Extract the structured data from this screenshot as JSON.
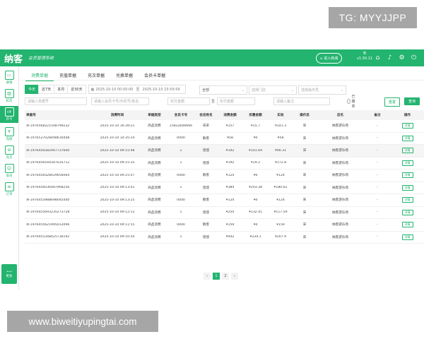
{
  "watermarks": {
    "top": "TG: MYYJJPP",
    "bottom": "www.biweitiyupingtai.com"
  },
  "colors": {
    "brand": "#23b46f",
    "header_bg": "#23b46f"
  },
  "header": {
    "logo": "纳客",
    "slogan": "会员管理系统",
    "enter_shop": "进入商城",
    "enter_shop_icon": "store-icon",
    "user_name": "宋",
    "version": "v1.50.11",
    "icons": [
      "home-icon",
      "bell-icon",
      "settings-icon",
      "power-icon"
    ]
  },
  "sidebar": {
    "items": [
      {
        "label": "收银",
        "icon": "cashier-icon"
      },
      {
        "label": "扣次",
        "icon": "deduct-icon"
      },
      {
        "label": "开卡",
        "icon": "vip-card-icon",
        "badge": "VIP"
      },
      {
        "label": "充值",
        "icon": "recharge-icon"
      },
      {
        "label": "充次",
        "icon": "recharge-times-icon"
      },
      {
        "label": "会员",
        "icon": "member-icon"
      },
      {
        "label": "订单",
        "icon": "order-icon"
      }
    ],
    "more": "更多"
  },
  "tabs": [
    "消费单据",
    "充值单据",
    "充次单据",
    "兑换单据",
    "会员卡单据"
  ],
  "active_tab": 0,
  "filters": {
    "date_buttons": [
      "今天",
      "近7天",
      "本月",
      "近30天"
    ],
    "date_start": "2025-10-10 00:00:00",
    "date_sep": "至",
    "date_end": "2025-10-10 23:59:59",
    "type_select": "全部",
    "store_select": "选择门店",
    "operator_select": "选择操作员",
    "order_no_placeholder": "请输入单据号",
    "member_placeholder": "请输入会员卡号/手机号/姓名",
    "amount_min_placeholder": "实付金额",
    "amount_sep": "至",
    "amount_max_placeholder": "实付金额",
    "remark_placeholder": "请输入备注",
    "revoked_label": "已撤单",
    "reset": "重置",
    "query": "查询"
  },
  "table": {
    "columns": [
      "单据号",
      "消费时间",
      "单据类型",
      "会员卡号",
      "会员姓名",
      "消费金额",
      "优惠金额",
      "实收",
      "操作员",
      "店名",
      "备注",
      "操作"
    ],
    "rows": [
      [
        "XF1976568221508799232",
        "2025-10-10 16:39:21",
        "商品消费",
        "15822606666",
        "宋宋",
        "¥157",
        "¥15.7",
        "¥141.3",
        "宋",
        "纳客游乐场",
        "-",
        "详情"
      ],
      [
        "XF1976537028448616448",
        "2025-10-10 14:35:24",
        "商品消费",
        "0000",
        "散客",
        "¥58",
        "¥0",
        "¥58",
        "宋",
        "纳客游乐场",
        "-",
        "详情"
      ],
      [
        "XF1976456582947737600",
        "2025-10-10 09:15:48",
        "商品消费",
        "1",
        "悠悠",
        "¥192",
        "¥101.69",
        "¥90.31",
        "宋",
        "纳客游乐场",
        "-",
        "详情"
      ],
      [
        "XF1976456544347635712",
        "2025-10-10 09:15:35",
        "商品消费",
        "1",
        "悠悠",
        "¥192",
        "¥19.2",
        "¥172.8",
        "宋",
        "纳客游乐场",
        "-",
        "详情"
      ],
      [
        "XF1976456428429656064",
        "2025-10-10 09:15:07",
        "商品消费",
        "0000",
        "散客",
        "¥124",
        "¥0",
        "¥124",
        "宋",
        "纳客游乐场",
        "-",
        "详情"
      ],
      [
        "XF1976456036487968256",
        "2025-10-10 09:13:41",
        "商品消费",
        "1",
        "悠悠",
        "¥384",
        "¥203.38",
        "¥180.62",
        "宋",
        "纳客游乐场",
        "-",
        "详情"
      ],
      [
        "XF1976455988698045440",
        "2025-10-10 09:13:25",
        "商品消费",
        "0000",
        "散客",
        "¥124",
        "¥0",
        "¥124",
        "宋",
        "纳客游乐场",
        "-",
        "详情"
      ],
      [
        "XF1976455693235273728",
        "2025-10-10 09:12:12",
        "商品消费",
        "1",
        "悠悠",
        "¥250",
        "¥132.41",
        "¥117.59",
        "宋",
        "纳客游乐场",
        "-",
        "详情"
      ],
      [
        "XF1976455621995012096",
        "2025-10-10 09:11:55",
        "商品消费",
        "0000",
        "散客",
        "¥159",
        "¥0",
        "¥159",
        "宋",
        "纳客游乐场",
        "-",
        "详情"
      ],
      [
        "XF1976455348425736192",
        "2025-10-10 09:10:50",
        "商品消费",
        "1",
        "悠悠",
        "¥442",
        "¥234.1",
        "¥207.9",
        "宋",
        "纳客游乐场",
        "-",
        "详情"
      ]
    ]
  },
  "pagination": {
    "prev": "‹",
    "pages": [
      "1",
      "2"
    ],
    "current": "1",
    "next": "›"
  }
}
